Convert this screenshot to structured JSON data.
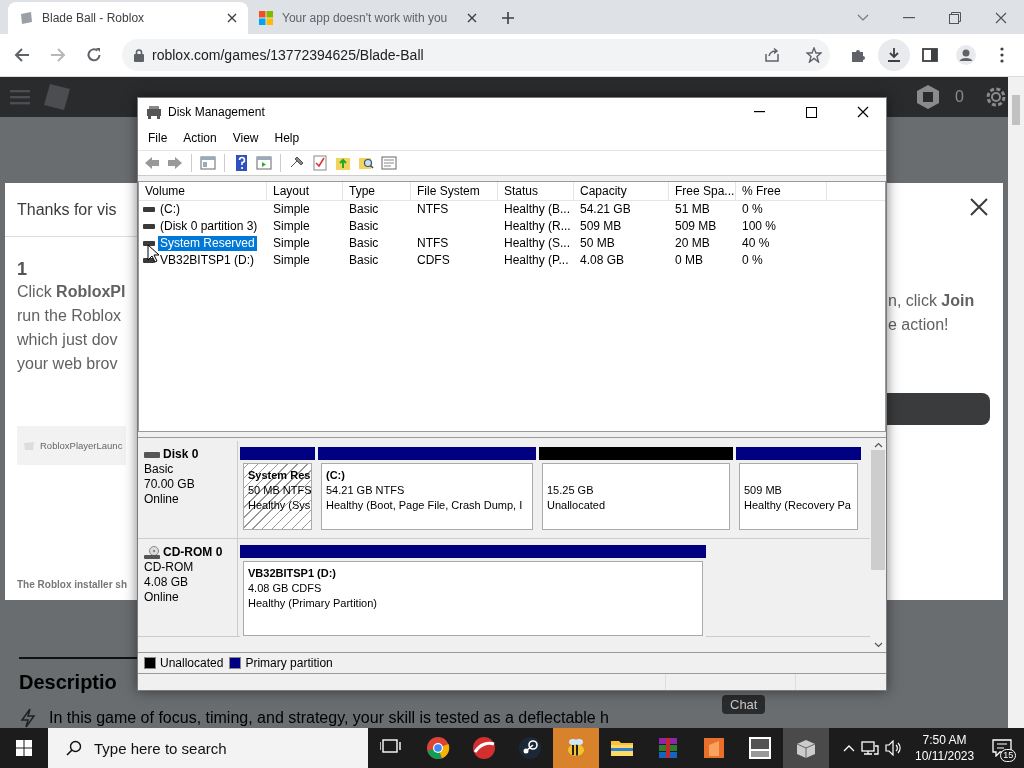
{
  "browser": {
    "tabs": [
      {
        "title": "Blade Ball - Roblox",
        "selected": true
      },
      {
        "title": "Your app doesn't work with you",
        "selected": false
      }
    ],
    "forward_disabled": true,
    "address": "roblox.com/games/13772394625/Blade-Ball"
  },
  "page": {
    "robux": "0",
    "modal": {
      "title": "Thanks for vis",
      "step": "1",
      "left_lines": [
        "Click **RobloxPl**",
        "run the Roblox",
        "which just dov",
        "your web brov"
      ],
      "right_lines": [
        "n, click **Join**",
        "e action!"
      ],
      "file": "RobloxPlayerLaunc",
      "note": "The Roblox installer sh"
    },
    "description_heading": "Descriptio",
    "description": "In this game of focus, timing, and strategy, your skill is tested as a deflectable h",
    "chat": "Chat"
  },
  "disk_management": {
    "title": "Disk Management",
    "menu": [
      "File",
      "Action",
      "View",
      "Help"
    ],
    "columns": [
      "Volume",
      "Layout",
      "Type",
      "File System",
      "Status",
      "Capacity",
      "Free Spa...",
      "% Free"
    ],
    "volumes": [
      {
        "volume": "(C:)",
        "layout": "Simple",
        "type": "Basic",
        "file_system": "NTFS",
        "status": "Healthy (B...",
        "capacity": "54.21 GB",
        "free_space": "51 MB",
        "percent_free": "0 %",
        "selected": false
      },
      {
        "volume": "(Disk 0 partition 3)",
        "layout": "Simple",
        "type": "Basic",
        "status": "Healthy (R...",
        "capacity": "509 MB",
        "free_space": "509 MB",
        "percent_free": "100 %",
        "selected": false
      },
      {
        "volume": "System Reserved",
        "layout": "Simple",
        "type": "Basic",
        "file_system": "NTFS",
        "status": "Healthy (S...",
        "capacity": "50 MB",
        "free_space": "20 MB",
        "percent_free": "40 %",
        "selected": true
      },
      {
        "volume": "VB32BITSP1 (D:)",
        "layout": "Simple",
        "type": "Basic",
        "file_system": "CDFS",
        "status": "Healthy (P...",
        "capacity": "4.08 GB",
        "free_space": "0 MB",
        "percent_free": "0 %",
        "selected": false
      }
    ],
    "disks": [
      {
        "kind": "disk",
        "name": "Disk 0",
        "type": "Basic",
        "size": "70.00 GB",
        "status": "Online",
        "partitions": [
          {
            "kind": "primary",
            "name": "System Res",
            "detail": "50 MB NTFS",
            "status": "Healthy (Sys",
            "selected": true
          },
          {
            "kind": "primary",
            "name": "(C:)",
            "detail": "54.21 GB NTFS",
            "status": "Healthy (Boot, Page File, Crash Dump, I",
            "selected": false
          },
          {
            "kind": "unallocated",
            "detail": "15.25 GB",
            "status": "Unallocated",
            "selected": false
          },
          {
            "kind": "primary",
            "detail": "509 MB",
            "status": "Healthy (Recovery Pa",
            "selected": false
          }
        ]
      },
      {
        "kind": "cdrom",
        "name": "CD-ROM 0",
        "type": "CD-ROM",
        "size": "4.08 GB",
        "status": "Online",
        "partitions": [
          {
            "kind": "primary",
            "name": "VB32BITSP1  (D:)",
            "detail": "4.08 GB CDFS",
            "status": "Healthy (Primary Partition)",
            "selected": false
          }
        ]
      }
    ],
    "legend": [
      {
        "kind": "unallocated",
        "label": "Unallocated",
        "color": "#000000"
      },
      {
        "kind": "primary",
        "label": "Primary partition",
        "color": "#000080"
      }
    ]
  },
  "taskbar": {
    "search_placeholder": "Type here to search",
    "apps": [
      {
        "kind": "taskview",
        "active": false
      },
      {
        "kind": "chrome",
        "active": false
      },
      {
        "kind": "redball",
        "active": false
      },
      {
        "kind": "steam",
        "active": false
      },
      {
        "kind": "bee",
        "active": true
      },
      {
        "kind": "folder",
        "active": false
      },
      {
        "kind": "archive",
        "active": false
      },
      {
        "kind": "orange",
        "active": false
      },
      {
        "kind": "sns",
        "active": false
      },
      {
        "kind": "box",
        "active": true
      }
    ],
    "time": "7:50 AM",
    "date": "10/11/2023",
    "notifications": "15"
  }
}
